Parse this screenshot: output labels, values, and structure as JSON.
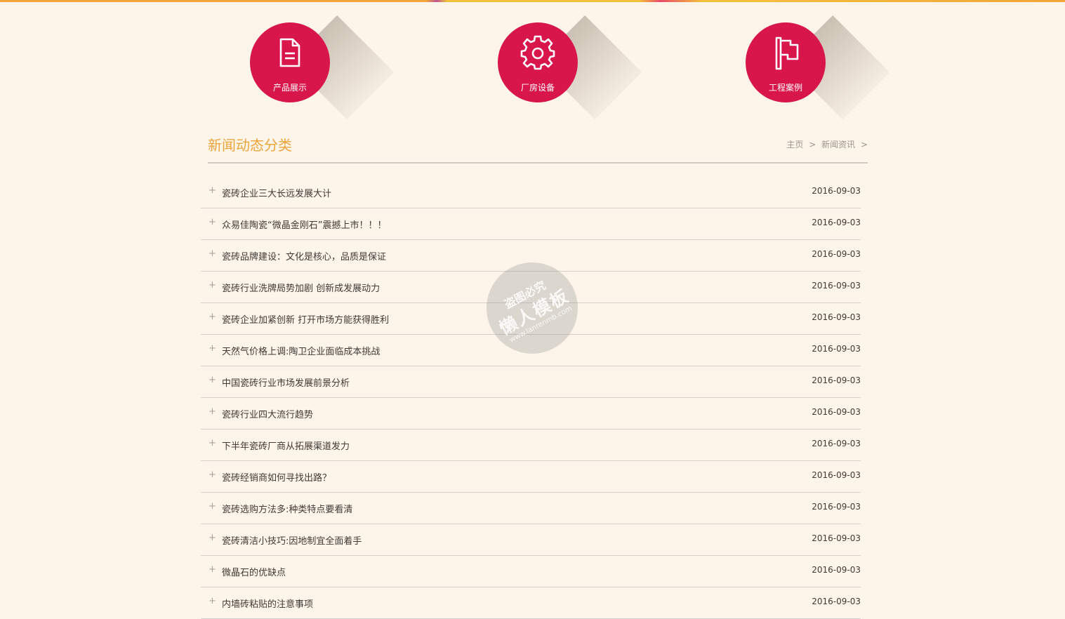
{
  "colors": {
    "background": "#fdf5e9",
    "accent_red": "#d8164c",
    "title_orange": "#eba53c",
    "text": "#3e3a36",
    "muted": "#9a958d"
  },
  "nav_circles": [
    {
      "label": "产品展示",
      "icon": "document-icon"
    },
    {
      "label": "厂房设备",
      "icon": "gear-icon"
    },
    {
      "label": "工程案例",
      "icon": "flag-icon"
    }
  ],
  "section": {
    "title": "新闻动态分类"
  },
  "breadcrumb": {
    "home": "主页",
    "current": "新闻资讯",
    "separator": ">"
  },
  "news": [
    {
      "title": "瓷砖企业三大长远发展大计",
      "date": "2016-09-03"
    },
    {
      "title": "众易佳陶瓷“微晶金刚石”震撼上市！！！",
      "date": "2016-09-03"
    },
    {
      "title": "瓷砖品牌建设：文化是核心，品质是保证",
      "date": "2016-09-03"
    },
    {
      "title": "瓷砖行业洗牌局势加剧 创新成发展动力",
      "date": "2016-09-03"
    },
    {
      "title": "瓷砖企业加紧创新 打开市场方能获得胜利",
      "date": "2016-09-03"
    },
    {
      "title": "天然气价格上调:陶卫企业面临成本挑战",
      "date": "2016-09-03"
    },
    {
      "title": "中国瓷砖行业市场发展前景分析",
      "date": "2016-09-03"
    },
    {
      "title": "瓷砖行业四大流行趋势",
      "date": "2016-09-03"
    },
    {
      "title": "下半年瓷砖厂商从拓展渠道发力",
      "date": "2016-09-03"
    },
    {
      "title": "瓷砖经销商如何寻找出路？",
      "date": "2016-09-03"
    },
    {
      "title": "瓷砖选购方法多:种类特点要看清",
      "date": "2016-09-03"
    },
    {
      "title": "瓷砖清洁小技巧:因地制宜全面着手",
      "date": "2016-09-03"
    },
    {
      "title": "微晶石的优缺点",
      "date": "2016-09-03"
    },
    {
      "title": "内墙砖粘贴的注意事项",
      "date": "2016-09-03"
    }
  ],
  "watermark": {
    "line1": "盗图必究",
    "line2": "懒人模板",
    "line3": "www.lanrenmb.com"
  }
}
